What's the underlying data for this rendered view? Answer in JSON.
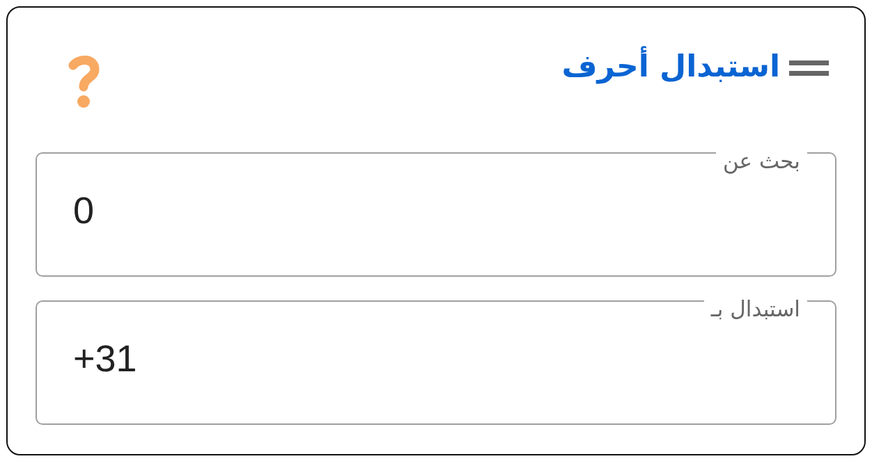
{
  "card": {
    "title": "استبدال أحرف"
  },
  "fields": [
    {
      "label": "بحث عن",
      "value": "0"
    },
    {
      "label": "استبدال بـ",
      "value": "+31"
    }
  ]
}
